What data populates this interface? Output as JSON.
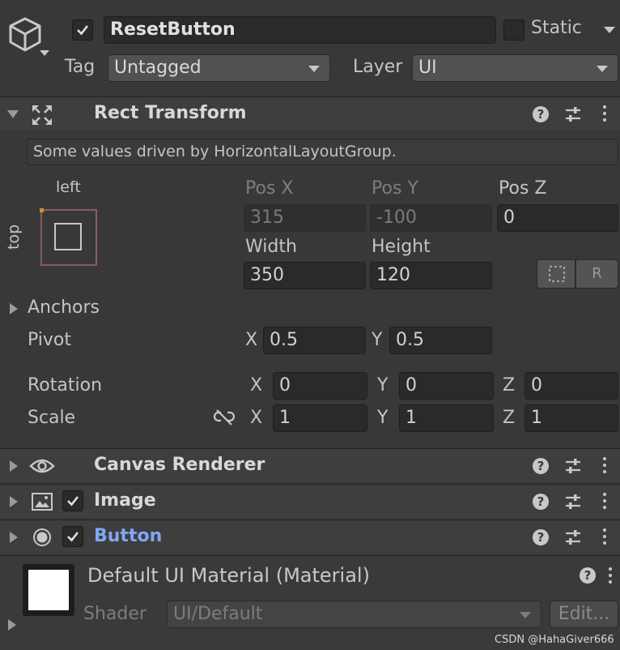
{
  "header": {
    "active_checked": true,
    "object_name": "ResetButton",
    "static_label": "Static",
    "tag_label": "Tag",
    "tag_value": "Untagged",
    "layer_label": "Layer",
    "layer_value": "UI"
  },
  "rect_transform": {
    "title": "Rect Transform",
    "info": "Some values driven by HorizontalLayoutGroup.",
    "anchor_preset": {
      "horizontal": "left",
      "vertical": "top"
    },
    "pos_x_label": "Pos X",
    "pos_y_label": "Pos Y",
    "pos_z_label": "Pos Z",
    "pos_x": "315",
    "pos_y": "-100",
    "pos_z": "0",
    "width_label": "Width",
    "height_label": "Height",
    "width": "350",
    "height": "120",
    "blueprint_button": "",
    "raw_button": "R",
    "anchors_label": "Anchors",
    "pivot_label": "Pivot",
    "pivot_x_label": "X",
    "pivot_y_label": "Y",
    "pivot_x": "0.5",
    "pivot_y": "0.5",
    "rotation_label": "Rotation",
    "rot_x_label": "X",
    "rot_y_label": "Y",
    "rot_z_label": "Z",
    "rot_x": "0",
    "rot_y": "0",
    "rot_z": "0",
    "scale_label": "Scale",
    "scale_x_label": "X",
    "scale_y_label": "Y",
    "scale_z_label": "Z",
    "scale_x": "1",
    "scale_y": "1",
    "scale_z": "1"
  },
  "components": {
    "canvas_renderer": "Canvas Renderer",
    "image": "Image",
    "button": "Button"
  },
  "material": {
    "name": "Default UI Material (Material)",
    "shader_label": "Shader",
    "shader_value": "UI/Default",
    "edit_button": "Edit..."
  },
  "watermark": "CSDN @HahaGiver666",
  "colors": {
    "background": "#383838",
    "header": "#3e3e3e",
    "field": "#2a2a2a",
    "button_title": "#7fa7f5",
    "anchor_orange": "#d08a3a"
  }
}
